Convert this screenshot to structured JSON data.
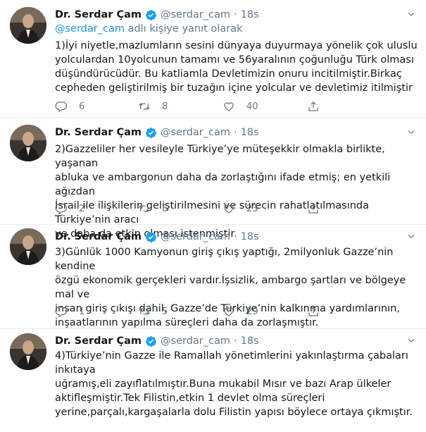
{
  "author": {
    "name": "Dr. Serdar Çam",
    "handle": "@serdar_cam",
    "time": "18s"
  },
  "replying_to": {
    "mention": "@serdar_cam",
    "suffix": " adlı kişiye yanıt olarak"
  },
  "tweets": [
    {
      "text": "1)İyi niyetle,mazlumların sesini dünyaya duyurmaya yönelik çok uluslu\nyolculardan 10yolcunun tamamı ve 56yaralının çoğunluğu Türk olması\ndüşündürücüdür. Bu katliamla Devletimizin onuru incitilmiştir.Birkaç\ncepheden geliştirilmiş bir tuzağın içine yolcular ve devletimiz itilmiştir",
      "replies": "6",
      "retweets": "8",
      "likes": "40"
    },
    {
      "text": "2)Gazzeliler her vesileyle Türkiye’ye müteşekkir olmakla birlikte, yaşanan\nabluka ve ambargonun daha da zorlaştığını ifade etmiş; en yetkili ağızdan\nİsrail ile ilişkilerin geliştirilmesini ve sürecin rahatlatılmasında Türkiye’nin aracı\nve daha da etkin olması istenmiştir.",
      "replies": "2",
      "retweets": "6",
      "likes": "23"
    },
    {
      "text": "3)Günlük 1000 Kamyonun giriş çıkış yaptığı, 2milyonluk Gazze’nin kendine\nözgü ekonomik gerçekleri vardır.İşsizlik, ambargo şartları ve bölgeye mal ve\ninsan giriş çıkışı dahil, Gazze’de Türkiye’nin kalkınma yardımlarının,\ninşaatlarının yapılma süreçleri daha da zorlaşmıştır.",
      "replies": "1",
      "retweets": "5",
      "likes": "29"
    },
    {
      "text": "4)Türkiye’nin Gazze ile Ramallah yönetimlerini yakınlaştırma çabaları inkıtaya\nuğramış,eli zayıflatılmıştır.Buna mukabil Mısır ve bazı Arap ülkeler\naktifleşmiştir.Tek Filistin,etkin 1 devlet olma süreçleri\nyerine,parçalı,kargaşalarla dolu Filistin yapısı böylece ortaya çıkmıştır.",
      "replies": "",
      "retweets": "",
      "likes": ""
    }
  ],
  "icons": {
    "verified": "verified-badge-icon",
    "caret": "chevron-down-icon",
    "reply": "reply-icon",
    "retweet": "retweet-icon",
    "like": "heart-icon",
    "share": "share-icon"
  },
  "colors": {
    "verified_blue": "#1da1f2",
    "mention_blue": "#1b95e0",
    "secondary_gray": "#657786",
    "divider": "#e6ecf0"
  }
}
